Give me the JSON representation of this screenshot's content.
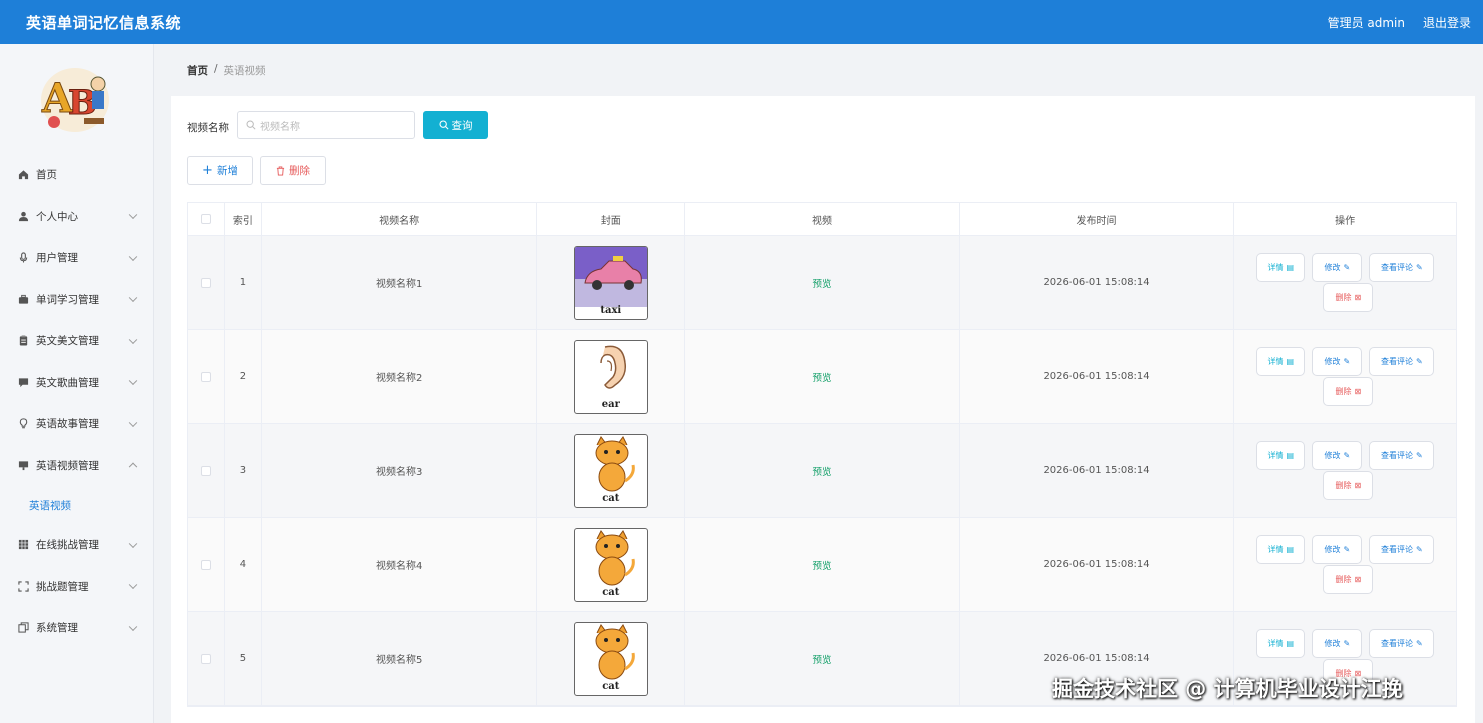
{
  "header": {
    "title": "英语单词记忆信息系统",
    "user": "管理员 admin",
    "logout": "退出登录"
  },
  "sidebar": {
    "items": [
      {
        "label": "首页",
        "icon": "home-icon",
        "has_children": false
      },
      {
        "label": "个人中心",
        "icon": "user-icon",
        "has_children": true
      },
      {
        "label": "用户管理",
        "icon": "mic-icon",
        "has_children": true
      },
      {
        "label": "单词学习管理",
        "icon": "briefcase-icon",
        "has_children": true
      },
      {
        "label": "英文美文管理",
        "icon": "clipboard-icon",
        "has_children": true
      },
      {
        "label": "英文歌曲管理",
        "icon": "message-icon",
        "has_children": true
      },
      {
        "label": "英语故事管理",
        "icon": "bulb-icon",
        "has_children": true
      },
      {
        "label": "英语视频管理",
        "icon": "video-icon",
        "has_children": true,
        "expanded": true
      }
    ],
    "active_sub": "英语视频",
    "items_after": [
      {
        "label": "在线挑战管理",
        "icon": "grid-icon",
        "has_children": true
      },
      {
        "label": "挑战题管理",
        "icon": "fullscreen-icon",
        "has_children": true
      },
      {
        "label": "系统管理",
        "icon": "copy-icon",
        "has_children": true
      }
    ]
  },
  "breadcrumb": {
    "home": "首页",
    "sep": "/",
    "current": "英语视频"
  },
  "search": {
    "label": "视频名称",
    "placeholder": "视频名称",
    "button": "查询"
  },
  "toolbar": {
    "add": "新增",
    "delete": "删除"
  },
  "table": {
    "columns": [
      "索引",
      "视频名称",
      "封面",
      "视频",
      "发布时间",
      "操作"
    ],
    "ops": {
      "detail": "详情",
      "edit": "修改",
      "comments": "查看评论",
      "remove": "删除"
    },
    "rows": [
      {
        "index": "1",
        "name": "视频名称1",
        "cover": "taxi",
        "video": "预览",
        "time": "2026-06-01 15:08:14"
      },
      {
        "index": "2",
        "name": "视频名称2",
        "cover": "ear",
        "video": "预览",
        "time": "2026-06-01 15:08:14"
      },
      {
        "index": "3",
        "name": "视频名称3",
        "cover": "cat",
        "video": "预览",
        "time": "2026-06-01 15:08:14"
      },
      {
        "index": "4",
        "name": "视频名称4",
        "cover": "cat",
        "video": "预览",
        "time": "2026-06-01 15:08:14"
      },
      {
        "index": "5",
        "name": "视频名称5",
        "cover": "cat",
        "video": "预览",
        "time": "2026-06-01 15:08:14"
      }
    ]
  },
  "watermark": "掘金技术社区 @ 计算机毕业设计江挽",
  "colors": {
    "primary": "#1e7fd8",
    "search_button": "#13b0d2",
    "danger": "#e65a5a",
    "preview": "#15a06a"
  }
}
